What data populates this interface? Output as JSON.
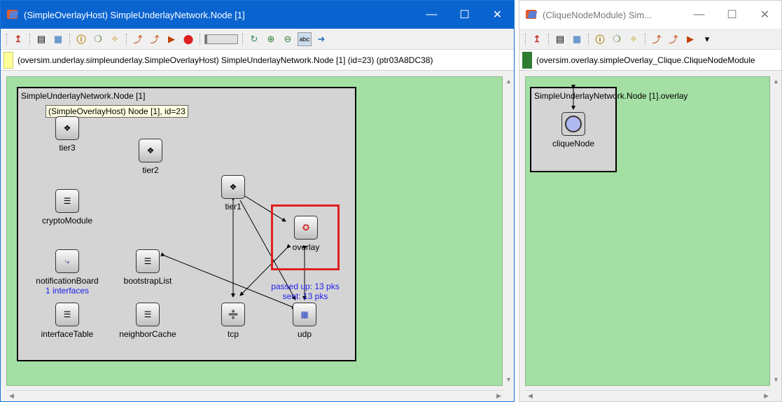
{
  "window1": {
    "title": "(SimpleOverlayHost) SimpleUnderlayNetwork.Node [1]",
    "path": "(oversim.underlay.simpleunderlay.SimpleOverlayHost) SimpleUnderlayNetwork.Node [1]  (id=23)  (ptr03A8DC38)",
    "path_color": "#ffff99",
    "module_title": "SimpleUnderlayNetwork.Node [1]",
    "tooltip": "(SimpleOverlayHost) Node [1], id=23",
    "nodes": {
      "tier3": "tier3",
      "tier2": "tier2",
      "tier1": "tier1",
      "crypto": "cryptoModule",
      "overlay": "overlay",
      "notification": "notificationBoard",
      "bootstrap": "bootstrapList",
      "interface_table": "interfaceTable",
      "neighbor_cache": "neighborCache",
      "tcp": "tcp",
      "udp": "udp"
    },
    "notification_sub": "1 interfaces",
    "udp_info_1": "passed up: 13 pks",
    "udp_info_2": "sent: 13 pks"
  },
  "window2": {
    "title": "(CliqueNodeModule) Sim...",
    "path": "(oversim.overlay.simpleOverlay_Clique.CliqueNodeModule",
    "path_color": "#2e7d32",
    "module_title": "SimpleUnderlayNetwork.Node [1].overlay",
    "node": "cliqueNode"
  },
  "colors": {
    "canvas_bg": "#a4e0a4",
    "module_bg": "#d4d4d4",
    "active_title": "#0a64d0",
    "highlight": "#e02020",
    "info_text": "#1c1cf0"
  },
  "icons": [
    "up-arrow-icon",
    "list-icon",
    "screen-icon",
    "info-icon",
    "object-icon",
    "search-icon",
    "step-icon",
    "fast-icon",
    "run-icon",
    "stop-icon",
    "refresh-icon",
    "zoom-in-icon",
    "zoom-out-icon",
    "labels-icon",
    "arrow-icon"
  ]
}
